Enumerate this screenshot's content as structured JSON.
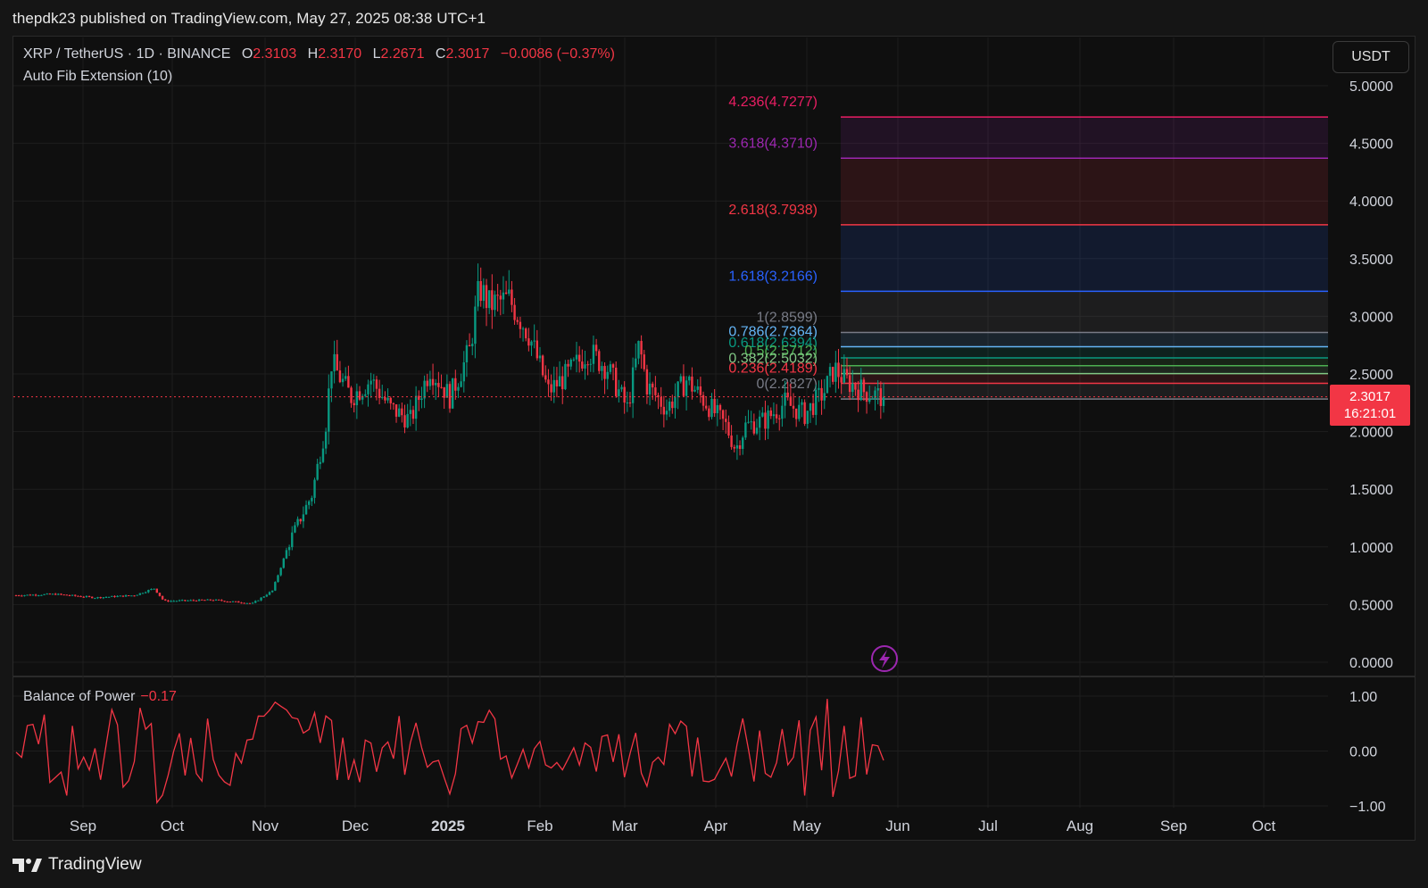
{
  "header": {
    "published": "thepdk23 published on TradingView.com, May 27, 2025 08:38 UTC+1"
  },
  "legend": {
    "symbol": "XRP / TetherUS · 1D · BINANCE",
    "o_label": "O",
    "o_value": "2.3103",
    "h_label": "H",
    "h_value": "2.3170",
    "l_label": "L",
    "l_value": "2.2671",
    "c_label": "C",
    "c_value": "2.3017",
    "change": "−0.0086 (−0.37%)",
    "indicator": "Auto Fib Extension (10)"
  },
  "currency_button": "USDT",
  "price_badge": {
    "price": "2.3017",
    "countdown": "16:21:01"
  },
  "bop": {
    "name": "Balance of Power",
    "value": "−0.17"
  },
  "footer": {
    "brand": "TradingView"
  },
  "colors": {
    "up": "#089981",
    "down": "#f23645",
    "background": "#0f0f0f",
    "grid": "#1e1e1e"
  },
  "icons": {
    "lightning": "lightning-bolt-icon",
    "logo": "tradingview-logo-icon"
  },
  "chart_data": {
    "type": "candlestick",
    "price_axis": {
      "min": 0,
      "max": 5,
      "ticks": [
        "0.0000",
        "0.5000",
        "1.0000",
        "1.5000",
        "2.0000",
        "2.5000",
        "3.0000",
        "3.5000",
        "4.0000",
        "4.5000",
        "5.0000"
      ],
      "tick_values": [
        0,
        0.5,
        1,
        1.5,
        2,
        2.5,
        3,
        3.5,
        4,
        4.5,
        5
      ]
    },
    "time_axis": {
      "labels": [
        "Sep",
        "Oct",
        "Nov",
        "Dec",
        "2025",
        "Feb",
        "Mar",
        "Apr",
        "May",
        "Jun",
        "Jul",
        "Aug",
        "Sep",
        "Oct"
      ],
      "bold": "2025"
    },
    "last_price": 2.3017,
    "fib_levels": [
      {
        "label": "4.236(4.7277)",
        "ratio": 4.236,
        "price": 4.7277,
        "color": "#e91e63"
      },
      {
        "label": "3.618(4.3710)",
        "ratio": 3.618,
        "price": 4.371,
        "color": "#9c27b0"
      },
      {
        "label": "2.618(3.7938)",
        "ratio": 2.618,
        "price": 3.7938,
        "color": "#f23645"
      },
      {
        "label": "1.618(3.2166)",
        "ratio": 1.618,
        "price": 3.2166,
        "color": "#2962ff"
      },
      {
        "label": "1(2.8599)",
        "ratio": 1,
        "price": 2.8599,
        "color": "#787b86"
      },
      {
        "label": "0.786(2.7364)",
        "ratio": 0.786,
        "price": 2.7364,
        "color": "#64b5f6"
      },
      {
        "label": "0.618(2.6394)",
        "ratio": 0.618,
        "price": 2.6394,
        "color": "#089981"
      },
      {
        "label": "0.5(2.5712)",
        "ratio": 0.5,
        "price": 2.5712,
        "color": "#4caf50"
      },
      {
        "label": "0.382(2.5032)",
        "ratio": 0.382,
        "price": 2.5032,
        "color": "#81c784"
      },
      {
        "label": "0.236(2.4189)",
        "ratio": 0.236,
        "price": 2.4189,
        "color": "#f23645"
      },
      {
        "label": "0(2.2827)",
        "ratio": 0,
        "price": 2.2827,
        "color": "#787b86"
      }
    ],
    "price_anchors": [
      {
        "week": 0,
        "close": 0.58
      },
      {
        "week": 2,
        "close": 0.59
      },
      {
        "week": 4,
        "close": 0.56
      },
      {
        "week": 6,
        "close": 0.58
      },
      {
        "week": 7,
        "close": 0.64
      },
      {
        "week": 7.5,
        "close": 0.53
      },
      {
        "week": 10,
        "close": 0.54
      },
      {
        "week": 12,
        "close": 0.51
      },
      {
        "week": 13,
        "close": 0.62
      },
      {
        "week": 14,
        "close": 1.1
      },
      {
        "week": 15,
        "close": 1.45
      },
      {
        "week": 15.7,
        "close": 2.05
      },
      {
        "week": 16,
        "close": 2.6
      },
      {
        "week": 17,
        "close": 2.3
      },
      {
        "week": 18,
        "close": 2.45
      },
      {
        "week": 19,
        "close": 2.2
      },
      {
        "week": 20,
        "close": 2.1
      },
      {
        "week": 21,
        "close": 2.55
      },
      {
        "week": 22,
        "close": 2.3
      },
      {
        "week": 23,
        "close": 2.7
      },
      {
        "week": 23.5,
        "close": 3.25
      },
      {
        "week": 24,
        "close": 3.1
      },
      {
        "week": 25,
        "close": 3.15
      },
      {
        "week": 26,
        "close": 2.85
      },
      {
        "week": 27,
        "close": 2.35
      },
      {
        "week": 28,
        "close": 2.5
      },
      {
        "week": 29,
        "close": 2.7
      },
      {
        "week": 30,
        "close": 2.55
      },
      {
        "week": 31,
        "close": 2.2
      },
      {
        "week": 31.6,
        "close": 2.75
      },
      {
        "week": 32,
        "close": 2.4
      },
      {
        "week": 33,
        "close": 2.2
      },
      {
        "week": 34,
        "close": 2.45
      },
      {
        "week": 35,
        "close": 2.25
      },
      {
        "week": 36,
        "close": 2.05
      },
      {
        "week": 36.5,
        "close": 1.85
      },
      {
        "week": 37,
        "close": 2.05
      },
      {
        "week": 38,
        "close": 2.1
      },
      {
        "week": 39,
        "close": 2.25
      },
      {
        "week": 40,
        "close": 2.15
      },
      {
        "week": 41,
        "close": 2.35
      },
      {
        "week": 41.5,
        "close": 2.55
      },
      {
        "week": 42,
        "close": 2.45
      },
      {
        "week": 43,
        "close": 2.35
      },
      {
        "week": 43.9,
        "close": 2.3017
      }
    ],
    "bop_axis": {
      "ticks": [
        "1.00",
        "0.00",
        "−1.00"
      ],
      "tick_values": [
        1,
        0,
        -1
      ]
    },
    "bop_last": -0.17
  }
}
